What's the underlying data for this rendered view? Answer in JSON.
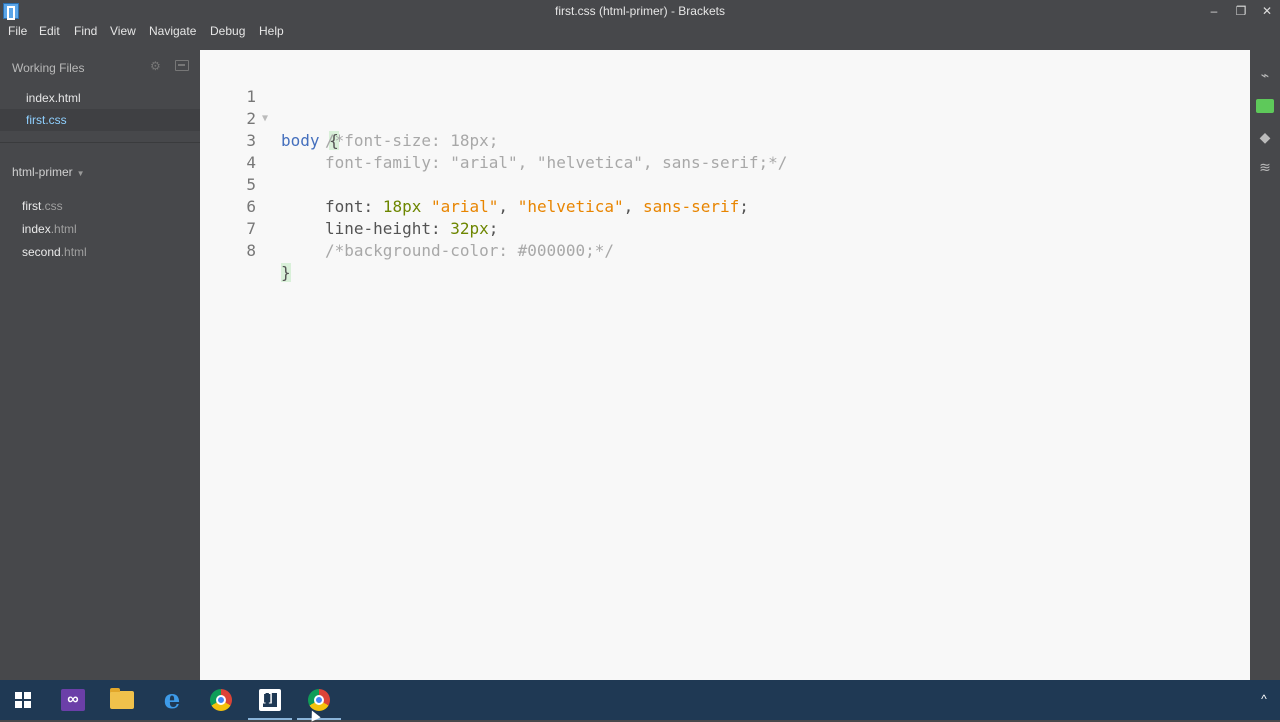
{
  "window": {
    "title": "first.css (html-primer) - Brackets",
    "controls": {
      "minimize": "–",
      "restore": "❐",
      "close": "✕"
    }
  },
  "menu": [
    "File",
    "Edit",
    "Find",
    "View",
    "Navigate",
    "Debug",
    "Help"
  ],
  "sidebar": {
    "working_files_label": "Working Files",
    "working_files": [
      {
        "name": "index.html"
      },
      {
        "name": "first.css"
      }
    ],
    "project_label": "html-primer",
    "project_files": [
      {
        "base": "first",
        "ext": ".css"
      },
      {
        "base": "index",
        "ext": ".html"
      },
      {
        "base": "second",
        "ext": ".html"
      }
    ]
  },
  "editor": {
    "line_numbers": [
      "1",
      "2",
      "3",
      "4",
      "5",
      "6",
      "7",
      "8"
    ],
    "lines": {
      "l1_sel": "body",
      "l1_brace": "{",
      "l2_cmt": "/*font-size: 18px;",
      "l3_cmt": "font-family: \"arial\", \"helvetica\", sans-serif;*/",
      "l5_prop": "font:",
      "l5_num": "18px",
      "l5_str1": "\"arial\"",
      "l5_sep1": ",",
      "l5_str2": "\"helvetica\"",
      "l5_sep2": ",",
      "l5_str3": "sans-serif",
      "l5_end": ";",
      "l6_prop": "line-height:",
      "l6_num": "32px",
      "l6_end": ";",
      "l7_cmt": "/*background-color: #000000;*/",
      "l8_brace": "}"
    }
  },
  "taskbar": {
    "apps": [
      "windows-start",
      "visual-studio",
      "file-explorer",
      "edge",
      "chrome",
      "brackets",
      "chrome"
    ],
    "tray_up": "^"
  },
  "colors": {
    "chrome_bg": "#47484b",
    "editor_bg": "#f8f8f8",
    "taskbar_bg": "#1f3954",
    "selector": "#446fbd",
    "number": "#6d8600",
    "string": "#e88501",
    "comment": "#a8a8a8",
    "active_file": "#8fd0ff"
  }
}
